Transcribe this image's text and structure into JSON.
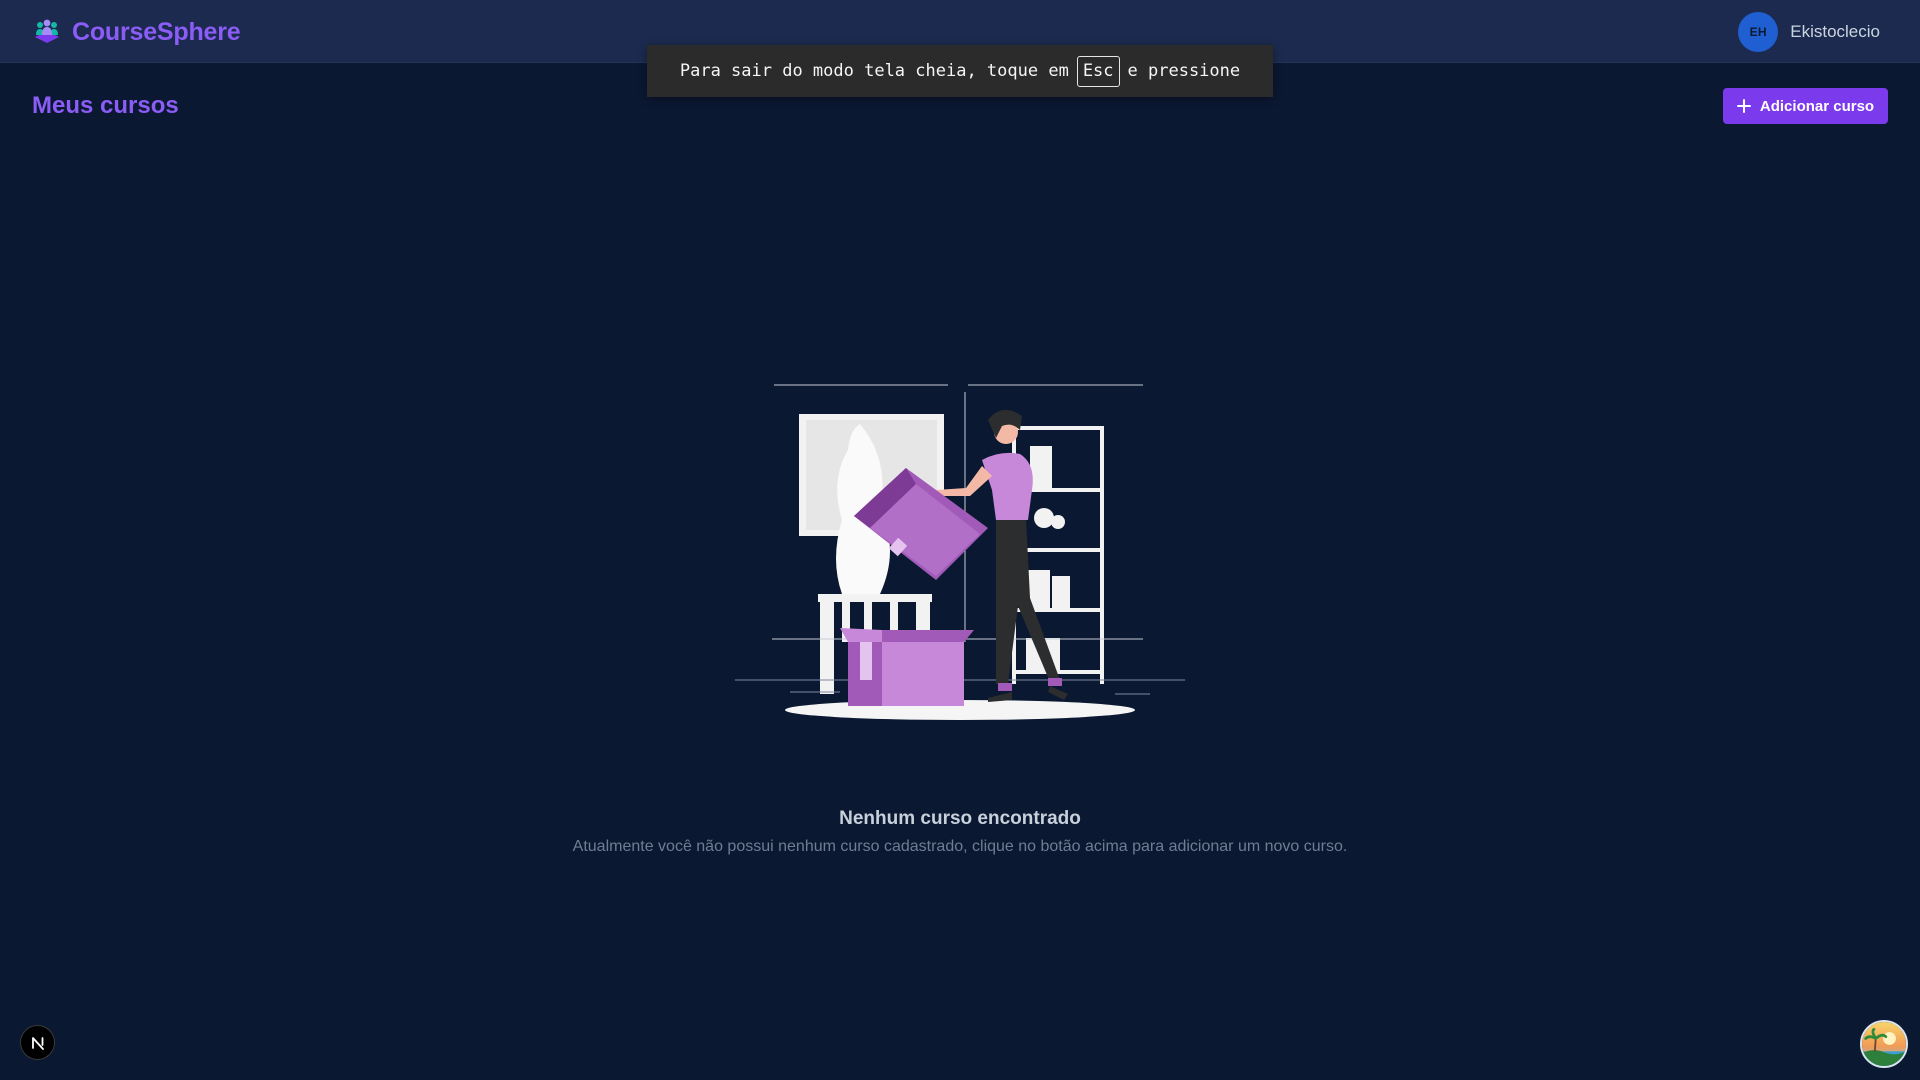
{
  "header": {
    "brand_name": "CourseSphere",
    "brand_icon": "users-group-icon",
    "user": {
      "initials": "EH",
      "name": "Ekistoclecio"
    }
  },
  "fullscreen_notice": {
    "before": "Para sair do modo tela cheia, toque em",
    "key": "Esc",
    "after": "e pressione"
  },
  "main": {
    "title": "Meus cursos",
    "add_button": {
      "label": "Adicionar curso",
      "icon": "plus-icon"
    },
    "empty_state": {
      "illustration": "empty-box-illustration",
      "title": "Nenhum curso encontrado",
      "description": "Atualmente você não possui nenhum curso cadastrado, clique no botão acima para adicionar um novo curso."
    }
  },
  "floating": {
    "dev_badge_icon": "nextjs-icon",
    "extension_icon": "landscape-extension-icon"
  },
  "colors": {
    "background": "#0b1831",
    "header": "#1b2a4e",
    "accent": "#7c3aed",
    "brand": "#8b5cf6",
    "avatar": "#1f5fd1"
  }
}
